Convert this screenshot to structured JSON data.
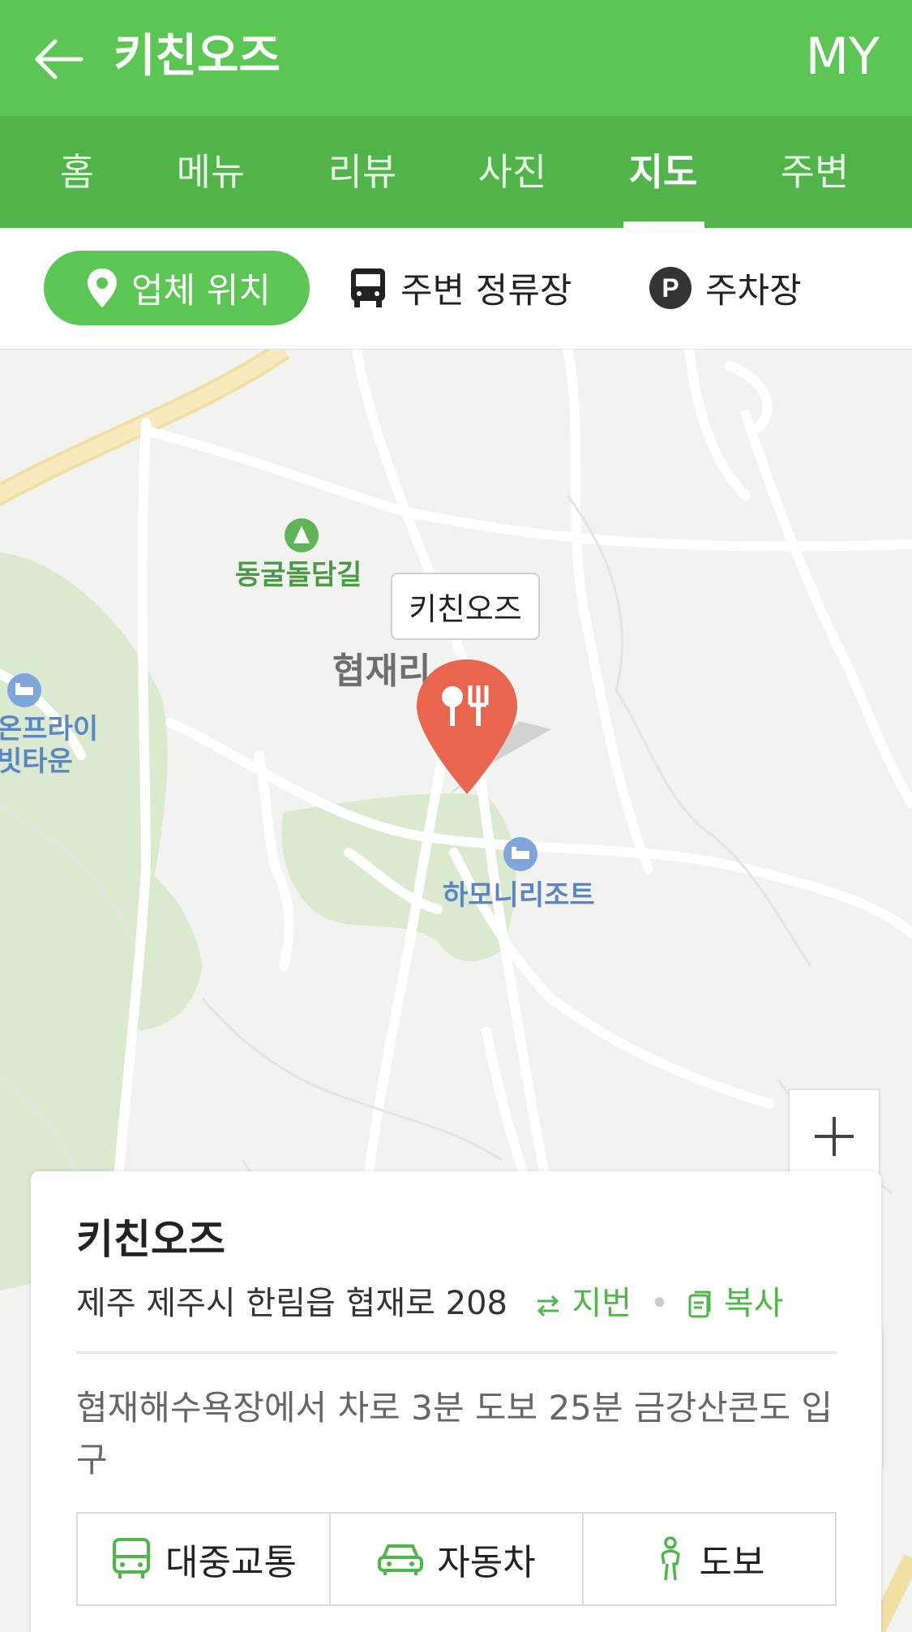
{
  "header": {
    "title": "키친오즈",
    "my_label": "MY"
  },
  "tabs": [
    {
      "label": "홈"
    },
    {
      "label": "메뉴"
    },
    {
      "label": "리뷰"
    },
    {
      "label": "사진"
    },
    {
      "label": "지도",
      "active": true
    },
    {
      "label": "주변"
    }
  ],
  "filters": [
    {
      "label": "업체 위치",
      "icon": "location-pin-icon",
      "active": true
    },
    {
      "label": "주변 정류장",
      "icon": "bus-icon"
    },
    {
      "label": "주차장",
      "icon": "parking-icon"
    }
  ],
  "map": {
    "marker_label": "키친오즈",
    "labels": {
      "trail": "동굴돌담길",
      "village": "협재리",
      "resort": "하모니리조트",
      "left_place_line1": "온프라이",
      "left_place_line2": "빗타운"
    }
  },
  "card": {
    "name": "키친오즈",
    "address": "제주 제주시 한림읍 협재로 208",
    "jibun_label": "지번",
    "copy_label": "복사",
    "description": "협재해수욕장에서 차로 3분 도보 25분 금강산콘도 입구",
    "routes": [
      {
        "label": "대중교통",
        "icon": "bus-outline-icon"
      },
      {
        "label": "자동차",
        "icon": "car-icon"
      },
      {
        "label": "도보",
        "icon": "walking-person-icon"
      }
    ]
  },
  "colors": {
    "brand_green": "#5bc654",
    "tab_green": "#51b44a",
    "marker_red": "#e8664e",
    "park_green": "#dbe9cf"
  }
}
